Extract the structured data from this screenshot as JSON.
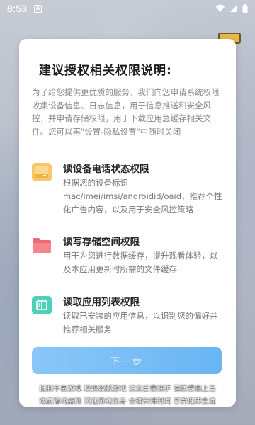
{
  "status_bar": {
    "time": "8:53",
    "notification_glyph": "A",
    "icons": [
      "wifi-icon",
      "signal-icon",
      "battery-icon"
    ]
  },
  "dialog": {
    "title": "建议授权相关权限说明:",
    "intro": "为了给您提供更优质的服务，我们向您申请系统权限收集设备信息、日志信息，用于信息推送和安全风控，并申请存储权限，用于下载应用急缓存相关文件。您可以再\"设置-隐私设置\"中随时关闭",
    "permissions": [
      {
        "icon": "phone-state-icon",
        "color": "#f7c86a",
        "name": "读设备电话状态权限",
        "desc": "根据您的设备标识mac/imei/imsi/androidid/oaid，推荐个性化广告内容，以及用于安全风控策略"
      },
      {
        "icon": "folder-icon",
        "color": "#ef6b73",
        "name": "读写存储空间权限",
        "desc": "用于为您进行数据缓存，提升观看体验，以及本应用更新时所需的文件缓存"
      },
      {
        "icon": "app-list-icon",
        "color": "#4fcfb8",
        "name": "读取应用列表权限",
        "desc": "读取已安装的应用信息，以识别您的偏好并推荐相关服务"
      }
    ],
    "next_label": "下一步",
    "accent": "#6fb8f4"
  },
  "health_notice": {
    "line1": "抵制不良游戏  拒绝盗版游戏  注意自我保护  谨防受骗上当",
    "line2": "适度游戏益脑  沉迷游戏伤身  合理安排时间  享受健康生活"
  }
}
